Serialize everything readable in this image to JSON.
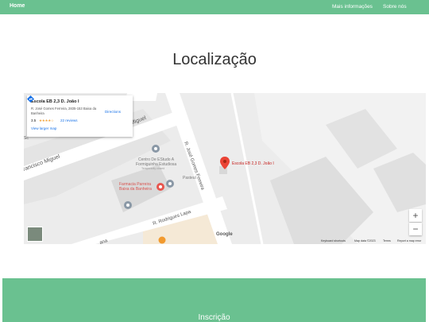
{
  "nav": {
    "home": "Home",
    "more_info": "Mais informações",
    "about": "Sobre nós"
  },
  "page": {
    "title": "Localização"
  },
  "map": {
    "card": {
      "title": "Escola EB 2,3 D. João I",
      "address": "R. José Gomes Ferreira, 2835-153 Baixa da Banheira",
      "rating": "3.5",
      "stars": "★★★★☆",
      "reviews": "22 reviews",
      "larger_map": "View larger map",
      "directions": "Directions"
    },
    "labels": {
      "street_top": "cisco Miguel",
      "street_left": "rancisco Miguel",
      "street_gomes": "R. José Gomes Ferreira",
      "street_lapa": "R. Rodrigues Lapa",
      "street_bottom": "ana",
      "school": "Escola EB 2,3 D. João I",
      "centro_line1": "Centro De EStudo A",
      "centro_line2": "Formiguinha Estudiosa",
      "centro_note": "Temporarily closed",
      "pastelaria": "Pasteul",
      "pharmacy_line1": "Farmacia Parreira",
      "pharmacy_line2": "Baixa da Banheira",
      "left_edge": "Sc"
    },
    "controls": {
      "zoom_in": "+",
      "zoom_out": "−"
    },
    "google": "Google",
    "attribution": {
      "shortcuts": "Keyboard shortcuts",
      "data": "Map data ©2023",
      "terms": "Terms",
      "report": "Report a map error"
    },
    "colors": {
      "pin": "#ea4335",
      "pharmacy": "#e8554e",
      "poi": "#7b8a98",
      "road": "#ffffff",
      "block": "#dcdcdc"
    }
  },
  "footer": {
    "label": "Inscrição"
  }
}
